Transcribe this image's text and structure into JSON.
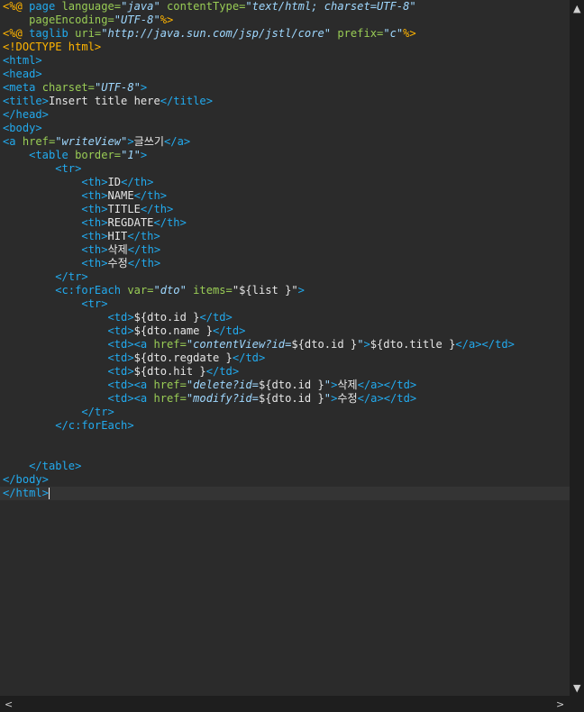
{
  "colors": {
    "background": "#2b2b2b",
    "directive": "#ffb400",
    "tag": "#22aaee",
    "attribute": "#99cc55",
    "value": "#9fd8ff",
    "text": "#e6e6e6"
  },
  "editor": {
    "current_line": 36,
    "lines": [
      [
        [
          "dir",
          "<%@ "
        ],
        [
          "tag",
          "page "
        ],
        [
          "attr",
          "language="
        ],
        [
          "val",
          "\"java\""
        ],
        [
          "attr",
          " contentType="
        ],
        [
          "val",
          "\"text/html; charset=UTF-8\""
        ]
      ],
      [
        [
          "text",
          "    "
        ],
        [
          "attr",
          "pageEncoding="
        ],
        [
          "val",
          "\"UTF-8\""
        ],
        [
          "dir",
          "%>"
        ]
      ],
      [
        [
          "dir",
          "<%@ "
        ],
        [
          "tag",
          "taglib "
        ],
        [
          "attr",
          "uri="
        ],
        [
          "val",
          "\"http://java.sun.com/jsp/jstl/core\""
        ],
        [
          "attr",
          " prefix="
        ],
        [
          "val",
          "\"c\""
        ],
        [
          "dir",
          "%>"
        ]
      ],
      [
        [
          "dir",
          "<!DOCTYPE html>"
        ]
      ],
      [
        [
          "tag",
          "<html>"
        ]
      ],
      [
        [
          "tag",
          "<head>"
        ]
      ],
      [
        [
          "tag",
          "<meta "
        ],
        [
          "attr",
          "charset="
        ],
        [
          "val",
          "\"UTF-8\""
        ],
        [
          "tag",
          ">"
        ]
      ],
      [
        [
          "tag",
          "<title>"
        ],
        [
          "text",
          "Insert title here"
        ],
        [
          "tag",
          "</title>"
        ]
      ],
      [
        [
          "tag",
          "</head>"
        ]
      ],
      [
        [
          "tag",
          "<body>"
        ]
      ],
      [
        [
          "tag",
          "<a "
        ],
        [
          "attr",
          "href="
        ],
        [
          "val",
          "\"writeView\""
        ],
        [
          "tag",
          ">"
        ],
        [
          "text",
          "글쓰기"
        ],
        [
          "tag",
          "</a>"
        ]
      ],
      [
        [
          "text",
          "    "
        ],
        [
          "tag",
          "<table "
        ],
        [
          "attr",
          "border="
        ],
        [
          "val",
          "\"1\""
        ],
        [
          "tag",
          ">"
        ]
      ],
      [
        [
          "text",
          "        "
        ],
        [
          "tag",
          "<tr>"
        ]
      ],
      [
        [
          "text",
          "            "
        ],
        [
          "tag",
          "<th>"
        ],
        [
          "text",
          "ID"
        ],
        [
          "tag",
          "</th>"
        ]
      ],
      [
        [
          "text",
          "            "
        ],
        [
          "tag",
          "<th>"
        ],
        [
          "text",
          "NAME"
        ],
        [
          "tag",
          "</th>"
        ]
      ],
      [
        [
          "text",
          "            "
        ],
        [
          "tag",
          "<th>"
        ],
        [
          "text",
          "TITLE"
        ],
        [
          "tag",
          "</th>"
        ]
      ],
      [
        [
          "text",
          "            "
        ],
        [
          "tag",
          "<th>"
        ],
        [
          "text",
          "REGDATE"
        ],
        [
          "tag",
          "</th>"
        ]
      ],
      [
        [
          "text",
          "            "
        ],
        [
          "tag",
          "<th>"
        ],
        [
          "text",
          "HIT"
        ],
        [
          "tag",
          "</th>"
        ]
      ],
      [
        [
          "text",
          "            "
        ],
        [
          "tag",
          "<th>"
        ],
        [
          "text",
          "삭제"
        ],
        [
          "tag",
          "</th>"
        ]
      ],
      [
        [
          "text",
          "            "
        ],
        [
          "tag",
          "<th>"
        ],
        [
          "text",
          "수정"
        ],
        [
          "tag",
          "</th>"
        ]
      ],
      [
        [
          "text",
          "        "
        ],
        [
          "tag",
          "</tr>"
        ]
      ],
      [
        [
          "text",
          "        "
        ],
        [
          "tag",
          "<c:forEach "
        ],
        [
          "attr",
          "var="
        ],
        [
          "val",
          "\"dto\""
        ],
        [
          "attr",
          " items="
        ],
        [
          "text",
          "\"${list }\""
        ],
        [
          "tag",
          ">"
        ]
      ],
      [
        [
          "text",
          "            "
        ],
        [
          "tag",
          "<tr>"
        ]
      ],
      [
        [
          "text",
          "                "
        ],
        [
          "tag",
          "<td>"
        ],
        [
          "text",
          "${dto.id }"
        ],
        [
          "tag",
          "</td>"
        ]
      ],
      [
        [
          "text",
          "                "
        ],
        [
          "tag",
          "<td>"
        ],
        [
          "text",
          "${dto.name }"
        ],
        [
          "tag",
          "</td>"
        ]
      ],
      [
        [
          "text",
          "                "
        ],
        [
          "tag",
          "<td><a "
        ],
        [
          "attr",
          "href="
        ],
        [
          "val",
          "\"contentView?id="
        ],
        [
          "text",
          "${dto.id }"
        ],
        [
          "val",
          "\""
        ],
        [
          "tag",
          ">"
        ],
        [
          "text",
          "${dto.title }"
        ],
        [
          "tag",
          "</a></td>"
        ]
      ],
      [
        [
          "text",
          "                "
        ],
        [
          "tag",
          "<td>"
        ],
        [
          "text",
          "${dto.regdate }"
        ],
        [
          "tag",
          "</td>"
        ]
      ],
      [
        [
          "text",
          "                "
        ],
        [
          "tag",
          "<td>"
        ],
        [
          "text",
          "${dto.hit }"
        ],
        [
          "tag",
          "</td>"
        ]
      ],
      [
        [
          "text",
          "                "
        ],
        [
          "tag",
          "<td><a "
        ],
        [
          "attr",
          "href="
        ],
        [
          "val",
          "\"delete?id="
        ],
        [
          "text",
          "${dto.id }"
        ],
        [
          "val",
          "\""
        ],
        [
          "tag",
          ">"
        ],
        [
          "text",
          "삭제"
        ],
        [
          "tag",
          "</a></td>"
        ]
      ],
      [
        [
          "text",
          "                "
        ],
        [
          "tag",
          "<td><a "
        ],
        [
          "attr",
          "href="
        ],
        [
          "val",
          "\"modify?id="
        ],
        [
          "text",
          "${dto.id }"
        ],
        [
          "val",
          "\""
        ],
        [
          "tag",
          ">"
        ],
        [
          "text",
          "수정"
        ],
        [
          "tag",
          "</a></td>"
        ]
      ],
      [
        [
          "text",
          "            "
        ],
        [
          "tag",
          "</tr>"
        ]
      ],
      [
        [
          "text",
          "        "
        ],
        [
          "tag",
          "</c:forEach>"
        ]
      ],
      [],
      [],
      [
        [
          "text",
          "    "
        ],
        [
          "tag",
          "</table>"
        ]
      ],
      [
        [
          "tag",
          "</body>"
        ]
      ],
      [
        [
          "tag",
          "</html>"
        ]
      ]
    ]
  },
  "scrollbars": {
    "up_icon": "▲",
    "down_icon": "▼",
    "left_icon": "<",
    "right_icon": ">"
  }
}
